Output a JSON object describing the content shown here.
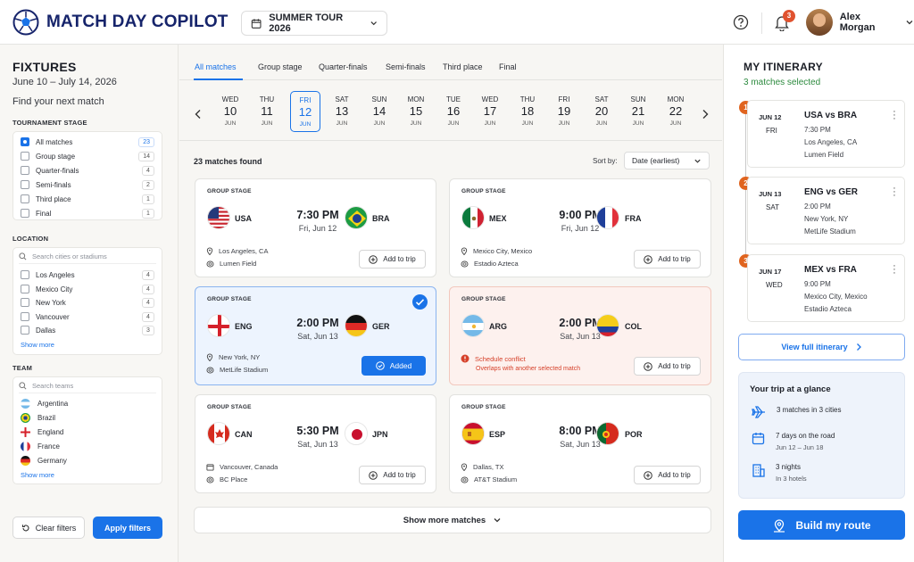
{
  "app": {
    "title": "MATCH DAY COPILOT"
  },
  "header": {
    "tour": "SUMMER TOUR 2026",
    "notifications": "3",
    "user": "Alex Morgan"
  },
  "colors": {
    "accent": "#1a73e8",
    "brand": "#16246b",
    "conflict": "#d6412a",
    "badge": "#e0641f",
    "success": "#2c8a3e"
  },
  "sidebar": {
    "title": "FIXTURES",
    "dates": "June 10 – July 14, 2026",
    "find": "Find your next match",
    "stage_title": "TOURNAMENT STAGE",
    "stages": [
      {
        "label": "All matches",
        "count": "23",
        "checked": true
      },
      {
        "label": "Group stage",
        "count": "14",
        "checked": false
      },
      {
        "label": "Quarter-finals",
        "count": "4",
        "checked": false
      },
      {
        "label": "Semi-finals",
        "count": "2",
        "checked": false
      },
      {
        "label": "Third place",
        "count": "1",
        "checked": false
      },
      {
        "label": "Final",
        "count": "1",
        "checked": false
      }
    ],
    "location_title": "LOCATION",
    "location_placeholder": "Search cities or stadiums",
    "locations": [
      {
        "label": "Los Angeles",
        "count": "4"
      },
      {
        "label": "Mexico City",
        "count": "4"
      },
      {
        "label": "New York",
        "count": "4"
      },
      {
        "label": "Vancouver",
        "count": "4"
      },
      {
        "label": "Dallas",
        "count": "3"
      }
    ],
    "show_more": "Show more",
    "team_title": "TEAM",
    "team_placeholder": "Search teams",
    "teams": [
      "Argentina",
      "Brazil",
      "England",
      "France",
      "Germany"
    ],
    "clear": "Clear filters",
    "apply": "Apply filters"
  },
  "tabs": [
    "All matches",
    "Group stage",
    "Quarter-finals",
    "Semi-finals",
    "Third place",
    "Final"
  ],
  "days": [
    {
      "w": "WED",
      "n": "10",
      "m": "JUN"
    },
    {
      "w": "THU",
      "n": "11",
      "m": "JUN"
    },
    {
      "w": "FRI",
      "n": "12",
      "m": "JUN"
    },
    {
      "w": "SAT",
      "n": "13",
      "m": "JUN"
    },
    {
      "w": "SUN",
      "n": "14",
      "m": "JUN"
    },
    {
      "w": "MON",
      "n": "15",
      "m": "JUN"
    },
    {
      "w": "TUE",
      "n": "16",
      "m": "JUN"
    },
    {
      "w": "WED",
      "n": "17",
      "m": "JUN"
    },
    {
      "w": "THU",
      "n": "18",
      "m": "JUN"
    },
    {
      "w": "FRI",
      "n": "19",
      "m": "JUN"
    },
    {
      "w": "SAT",
      "n": "20",
      "m": "JUN"
    },
    {
      "w": "SUN",
      "n": "21",
      "m": "JUN"
    },
    {
      "w": "MON",
      "n": "22",
      "m": "JUN"
    }
  ],
  "results": {
    "found": "23 matches found",
    "sort_label": "Sort by:",
    "sort_value": "Date (earliest)"
  },
  "matches": [
    {
      "stage": "GROUP STAGE",
      "home": "USA",
      "away": "BRA",
      "time": "7:30 PM",
      "date": "Fri, Jun 12",
      "city": "Los Angeles, CA",
      "venue": "Lumen Field",
      "action": "Add to trip"
    },
    {
      "stage": "GROUP STAGE",
      "home": "MEX",
      "away": "FRA",
      "time": "9:00 PM",
      "date": "Fri, Jun 12",
      "city": "Mexico City, Mexico",
      "venue": "Estadio Azteca",
      "action": "Add to trip"
    },
    {
      "stage": "GROUP STAGE",
      "home": "ENG",
      "away": "GER",
      "time": "2:00 PM",
      "date": "Sat, Jun 13",
      "city": "New York, NY",
      "venue": "MetLife Stadium",
      "action": "Added"
    },
    {
      "stage": "GROUP STAGE",
      "home": "ARG",
      "away": "COL",
      "time": "2:00 PM",
      "date": "Sat, Jun 13",
      "conflict": "Schedule conflict",
      "conflict_detail": "Overlaps with another selected match",
      "action": "Add to trip"
    },
    {
      "stage": "GROUP STAGE",
      "home": "CAN",
      "away": "JPN",
      "time": "5:30 PM",
      "date": "Sat, Jun 13",
      "city": "Vancouver, Canada",
      "venue": "BC Place",
      "action": "Add to trip"
    },
    {
      "stage": "GROUP STAGE",
      "home": "ESP",
      "away": "POR",
      "time": "8:00 PM",
      "date": "Sat, Jun 13",
      "city": "Dallas, TX",
      "venue": "AT&T Stadium",
      "action": "Add to trip"
    }
  ],
  "show_more_matches": "Show more matches",
  "itinerary": {
    "title": "MY ITINERARY",
    "selected": "3 matches selected",
    "items": [
      {
        "num": "1",
        "date": "JUN 12",
        "day": "FRI",
        "match": "USA vs BRA",
        "time": "7:30 PM",
        "city": "Los Angeles, CA",
        "venue": "Lumen Field"
      },
      {
        "num": "2",
        "date": "JUN 13",
        "day": "SAT",
        "match": "ENG vs GER",
        "time": "2:00 PM",
        "city": "New York, NY",
        "venue": "MetLife Stadium"
      },
      {
        "num": "3",
        "date": "JUN 17",
        "day": "WED",
        "match": "MEX vs FRA",
        "time": "9:00 PM",
        "city": "Mexico City, Mexico",
        "venue": "Estadio Azteca"
      }
    ],
    "view_full": "View full itinerary",
    "glance_title": "Your trip at a glance",
    "glance": [
      {
        "icon": "plane-icon",
        "t1": "3 matches in 3 cities",
        "t2": ""
      },
      {
        "icon": "calendar-icon",
        "t1": "7 days on the road",
        "t2": "Jun 12 – Jun 18"
      },
      {
        "icon": "hotel-icon",
        "t1": "3 nights",
        "t2": "In 3 hotels"
      }
    ],
    "build": "Build my route"
  }
}
